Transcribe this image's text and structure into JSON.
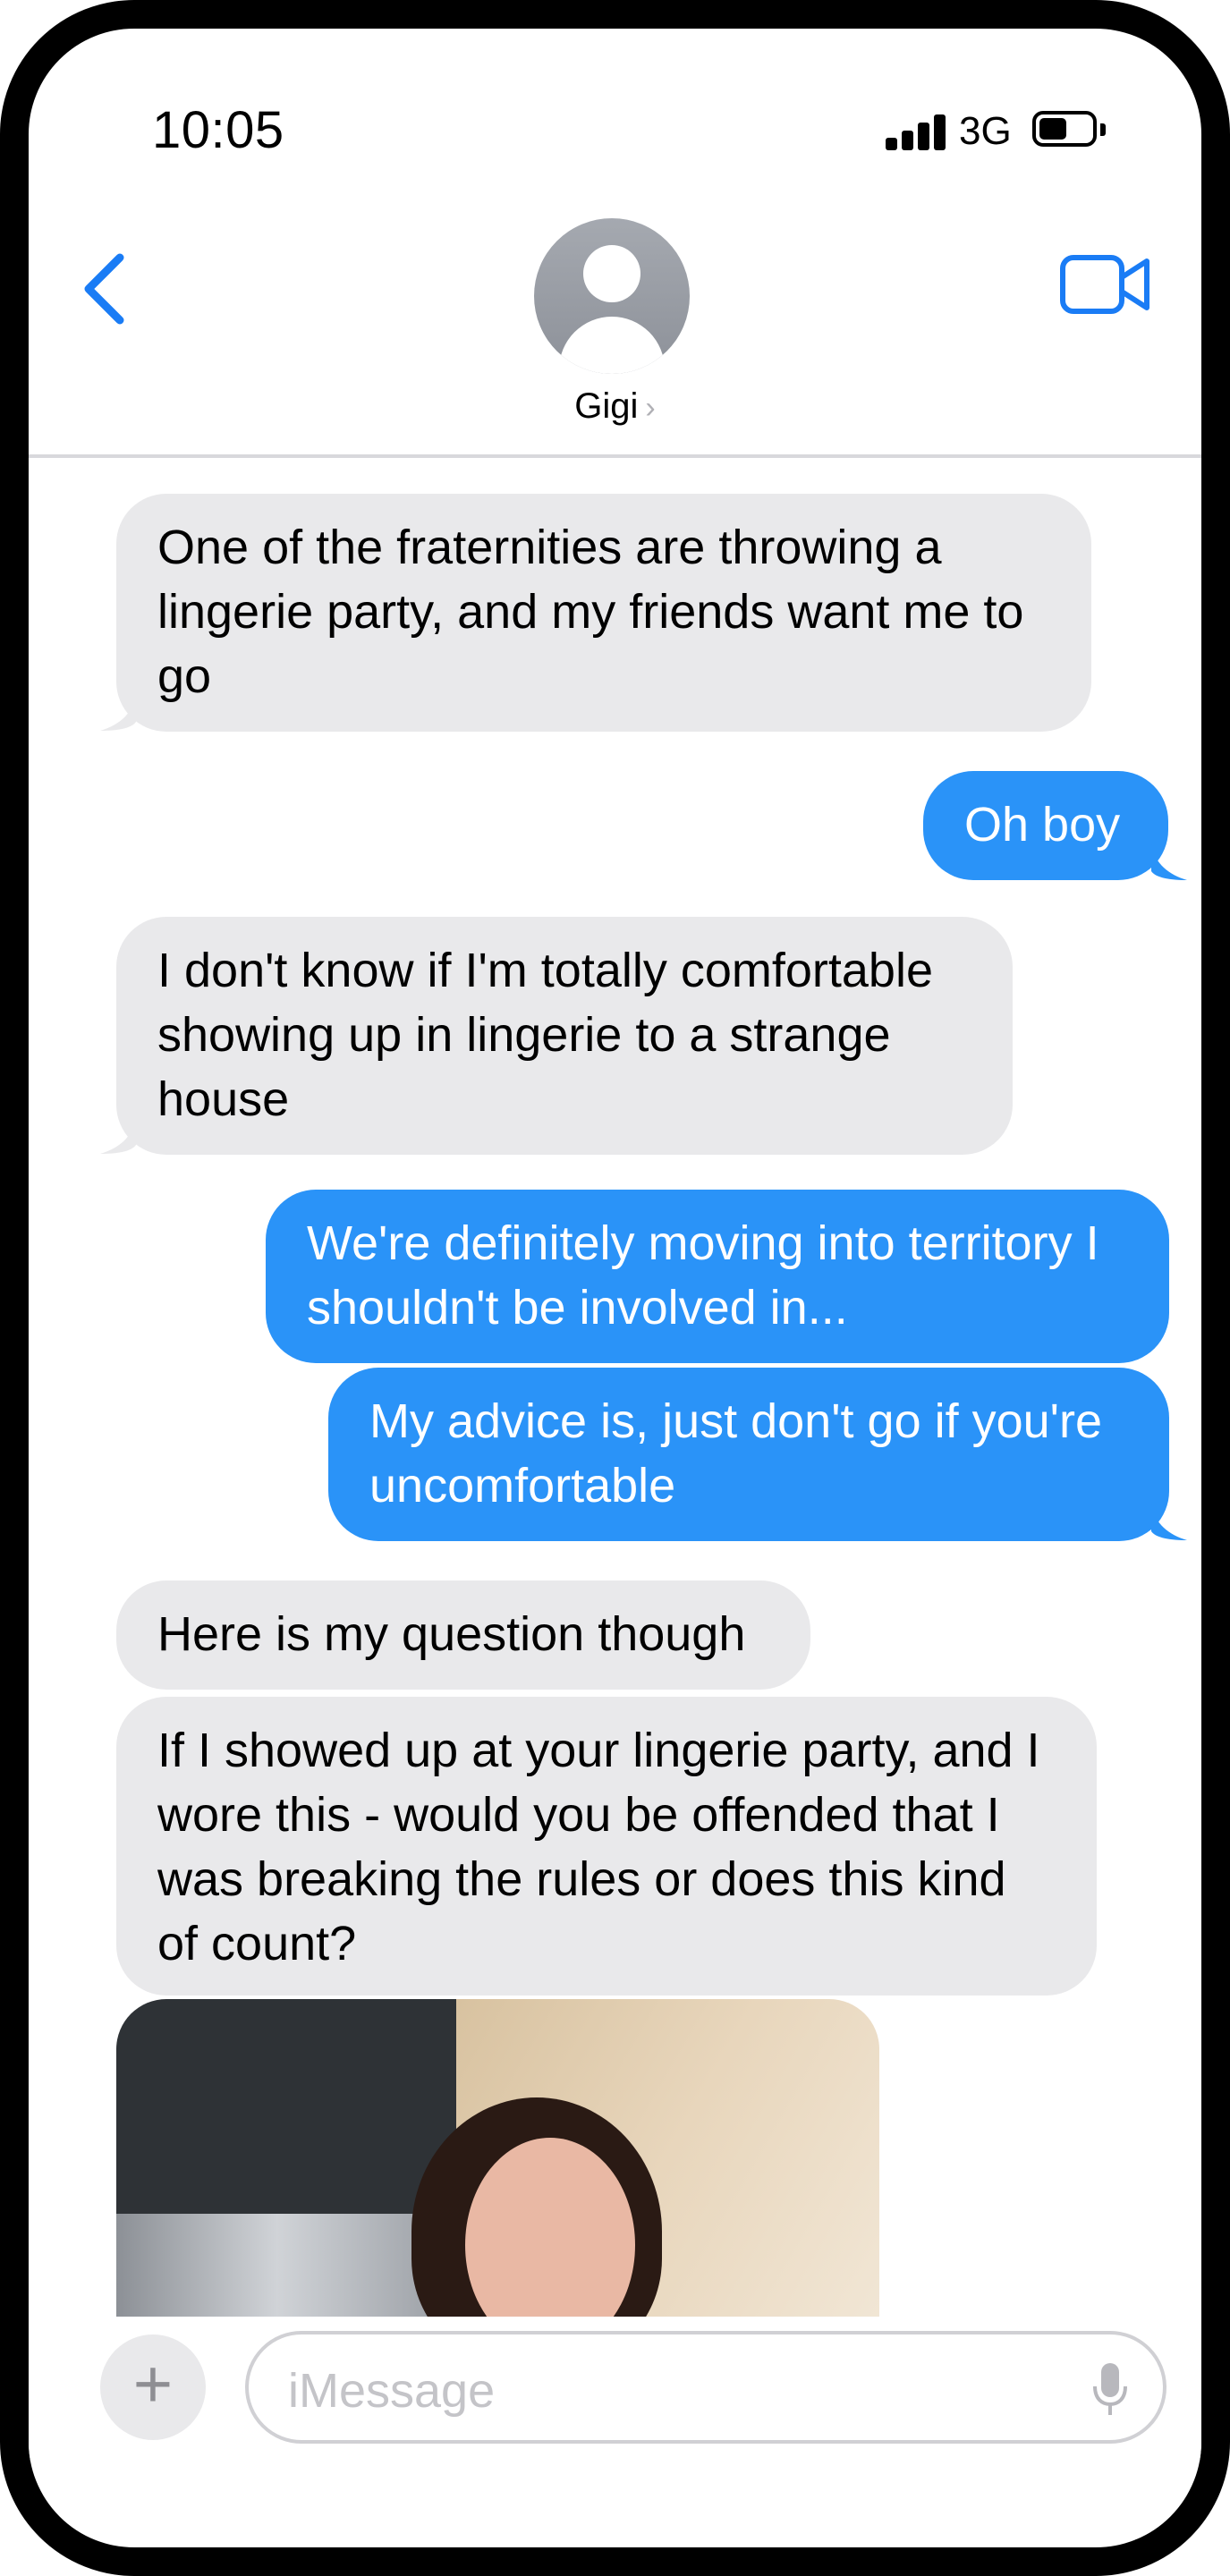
{
  "status_bar": {
    "time": "10:05",
    "network": "3G"
  },
  "header": {
    "contact_name": "Gigi",
    "icons": [
      "back-chevron-icon",
      "avatar",
      "chevron-right-icon",
      "video-call-icon"
    ]
  },
  "messages": [
    {
      "direction": "received",
      "text": "One of the fraternities are throwing a lingerie party, and my friends want me to go"
    },
    {
      "direction": "sent",
      "text": "Oh boy"
    },
    {
      "direction": "received",
      "text": "I don't know if I'm totally comfortable showing up in lingerie to a strange house"
    },
    {
      "direction": "sent",
      "text": "We're definitely moving into territory I shouldn't be involved in..."
    },
    {
      "direction": "sent",
      "text": "My advice is, just don't go if you're uncomfortable"
    },
    {
      "direction": "received",
      "text": "Here is my question though"
    },
    {
      "direction": "received",
      "text": "If I showed up at your lingerie party, and I wore this - would you be offended that I was breaking the rules or does this kind of count?"
    },
    {
      "direction": "received",
      "type": "photo"
    }
  ],
  "input": {
    "placeholder": "iMessage"
  },
  "colors": {
    "sent_bubble": "#2a93f8",
    "received_bubble": "#e9e9eb",
    "accent": "#1a7cf5"
  }
}
